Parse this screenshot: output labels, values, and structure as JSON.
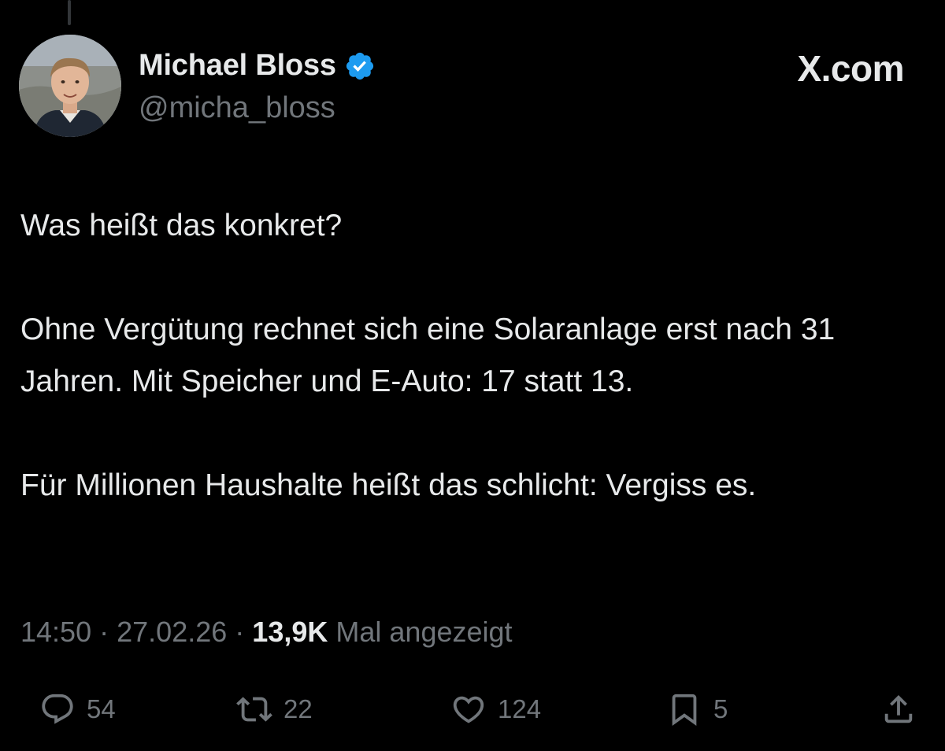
{
  "author": {
    "display_name": "Michael Bloss",
    "handle": "@micha_bloss",
    "verified_icon": "verified-badge-icon"
  },
  "brand": {
    "label": "X.com"
  },
  "tweet": {
    "paragraphs": [
      "Was heißt das konkret?",
      "Ohne Vergütung rechnet sich eine Solaranlage erst nach 31 Jahren. Mit Speicher und E-Auto: 17 statt 13.",
      "Für Millionen Haushalte heißt das schlicht: Vergiss es."
    ]
  },
  "meta": {
    "time": "14:50",
    "date": "27.02.26",
    "separator": "·",
    "views_count": "13,9K",
    "views_label": "Mal angezeigt"
  },
  "actions": {
    "reply_count": "54",
    "repost_count": "22",
    "like_count": "124",
    "bookmark_count": "5"
  },
  "colors": {
    "background": "#000000",
    "text_primary": "#e7e9ea",
    "text_secondary": "#71767b",
    "verified": "#1d9bf0"
  }
}
